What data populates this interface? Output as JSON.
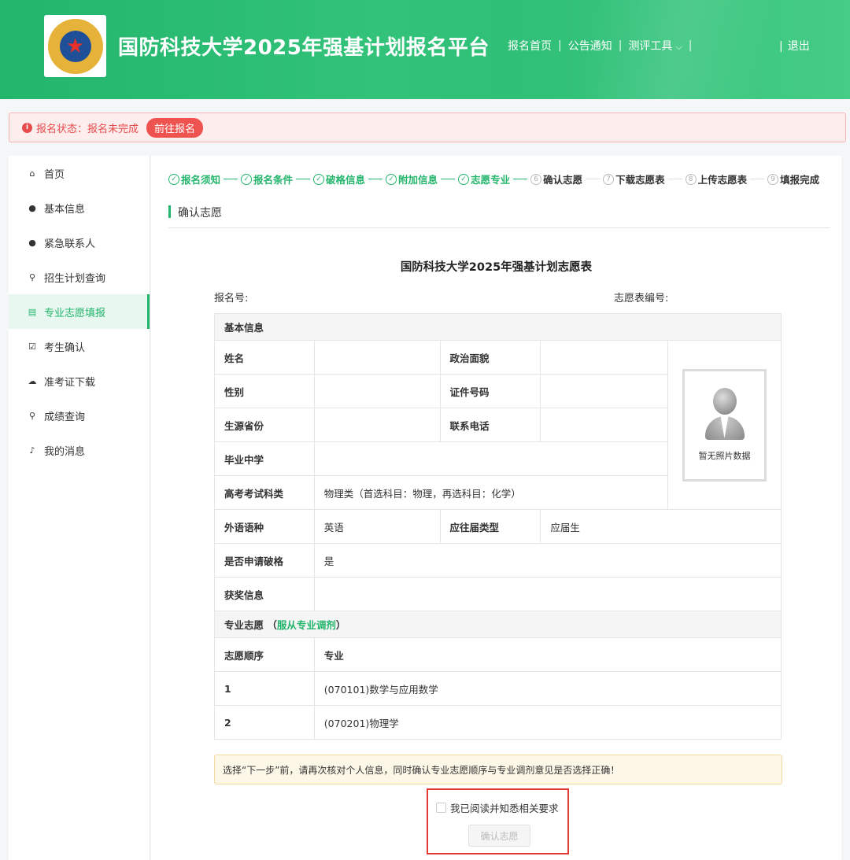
{
  "header": {
    "title": "国防科技大学2025年强基计划报名平台",
    "nav": [
      "报名首页",
      "公告通知",
      "测评工具"
    ],
    "logout": "退出",
    "brand_color": "#2fbf77"
  },
  "status": {
    "text": "报名状态：报名未完成",
    "action": "前往报名"
  },
  "sidebar": {
    "items": [
      {
        "label": "首页",
        "icon": "home-icon"
      },
      {
        "label": "基本信息",
        "icon": "user-icon"
      },
      {
        "label": "紧急联系人",
        "icon": "user-icon"
      },
      {
        "label": "招生计划查询",
        "icon": "search-icon"
      },
      {
        "label": "专业志愿填报",
        "icon": "form-icon",
        "active": true
      },
      {
        "label": "考生确认",
        "icon": "check-square-icon"
      },
      {
        "label": "准考证下载",
        "icon": "cloud-download-icon"
      },
      {
        "label": "成绩查询",
        "icon": "search-icon"
      },
      {
        "label": "我的消息",
        "icon": "bell-icon"
      }
    ]
  },
  "steps": [
    {
      "num": "✓",
      "label": "报名须知",
      "done": true
    },
    {
      "num": "✓",
      "label": "报名条件",
      "done": true
    },
    {
      "num": "✓",
      "label": "破格信息",
      "done": true
    },
    {
      "num": "✓",
      "label": "附加信息",
      "done": true
    },
    {
      "num": "✓",
      "label": "志愿专业",
      "done": true
    },
    {
      "num": "6",
      "label": "确认志愿",
      "done": false
    },
    {
      "num": "7",
      "label": "下载志愿表",
      "done": false
    },
    {
      "num": "8",
      "label": "上传志愿表",
      "done": false
    },
    {
      "num": "9",
      "label": "填报完成",
      "done": false
    }
  ],
  "section_title": "确认志愿",
  "form": {
    "title": "国防科技大学2025年强基计划志愿表",
    "reg_no_label": "报名号:",
    "form_no_label": "志愿表编号:",
    "basic_info_header": "基本信息",
    "name_label": "姓名",
    "political_label": "政治面貌",
    "gender_label": "性别",
    "id_label": "证件号码",
    "province_label": "生源省份",
    "phone_label": "联系电话",
    "school_label": "毕业中学",
    "exam_subject_label": "高考考试科类",
    "exam_subject_value": "物理类（首选科目：物理，再选科目：化学）",
    "language_label": "外语语种",
    "language_value": "英语",
    "grad_type_label": "应往届类型",
    "grad_type_value": "应届生",
    "exception_label": "是否申请破格",
    "exception_value": "是",
    "award_label": "获奖信息",
    "photo_caption": "暂无照片数据",
    "major_header_prefix": "专业志愿 （",
    "major_header_link": "服从专业调剂",
    "major_header_suffix": "）",
    "order_col": "志愿顺序",
    "major_col": "专业",
    "majors": [
      {
        "order": "1",
        "name": "(070101)数学与应用数学"
      },
      {
        "order": "2",
        "name": "(070201)物理学"
      }
    ]
  },
  "notice": "选择“下一步”前，请再次核对个人信息，同时确认专业志愿顺序与专业调剂意见是否选择正确！",
  "agree_label": "我已阅读并知悉相关要求",
  "confirm_button": "确认志愿"
}
